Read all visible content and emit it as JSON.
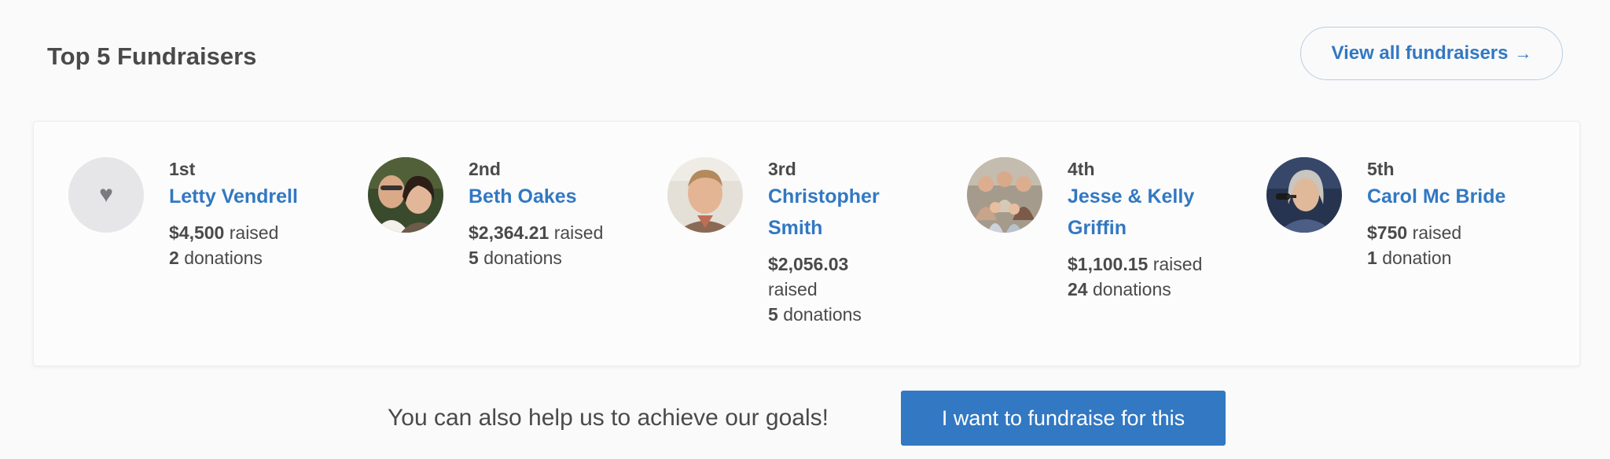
{
  "header": {
    "title": "Top 5 Fundraisers",
    "view_all_label": "View all fundraisers",
    "view_all_icon": "arrow-right-icon"
  },
  "fundraisers": [
    {
      "rank": "1st",
      "name_lines": [
        "Letty Vendrell"
      ],
      "amount": "$4,500",
      "raised_label": "raised",
      "donation_count": "2",
      "donation_label": "donations",
      "avatar": "heart-icon"
    },
    {
      "rank": "2nd",
      "name_lines": [
        "Beth Oakes"
      ],
      "amount": "$2,364.21",
      "raised_label": "raised",
      "donation_count": "5",
      "donation_label": "donations",
      "avatar": "photo"
    },
    {
      "rank": "3rd",
      "name_lines": [
        "Christopher",
        "Smith"
      ],
      "amount": "$2,056.03",
      "raised_label": "raised",
      "donation_count": "5",
      "donation_label": "donations",
      "avatar": "photo"
    },
    {
      "rank": "4th",
      "name_lines": [
        "Jesse & Kelly",
        "Griffin"
      ],
      "amount": "$1,100.15",
      "raised_label": "raised",
      "donation_count": "24",
      "donation_label": "donations",
      "avatar": "photo"
    },
    {
      "rank": "5th",
      "name_lines": [
        "Carol Mc Bride"
      ],
      "amount": "$750",
      "raised_label": "raised",
      "donation_count": "1",
      "donation_label": "donation",
      "avatar": "photo"
    }
  ],
  "cta": {
    "text": "You can also help us to achieve our goals!",
    "button_label": "I want to fundraise for this"
  },
  "colors": {
    "accent": "#3278c2",
    "text": "#4a4a4a",
    "background": "#fafafa"
  }
}
